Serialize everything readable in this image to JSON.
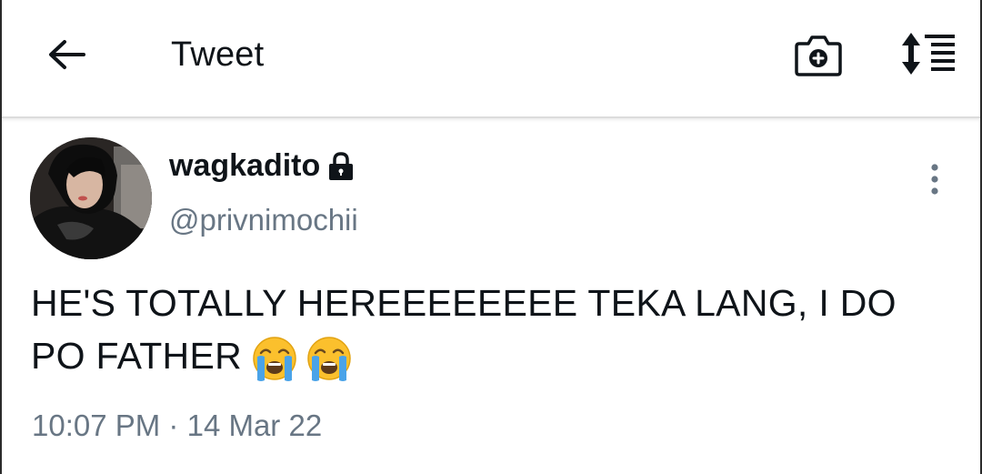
{
  "header": {
    "title": "Tweet",
    "back_icon": "arrow-left-icon",
    "camera_icon": "camera-plus-icon",
    "sort_icon": "sort-list-icon"
  },
  "tweet": {
    "display_name": "wagkadito",
    "protected_icon": "lock-icon",
    "handle": "@privnimochii",
    "text": "HE'S TOTALLY HEREEEEEEEE TEKA LANG, I DO PO FATHER",
    "emojis": [
      "loudly-crying-face",
      "loudly-crying-face"
    ],
    "time": "10:07 PM",
    "separator": "·",
    "date": "14 Mar 22",
    "more_icon": "more-vertical-icon"
  },
  "colors": {
    "text_primary": "#0f1419",
    "text_secondary": "#687684",
    "header_border": "#dcdcdc"
  }
}
